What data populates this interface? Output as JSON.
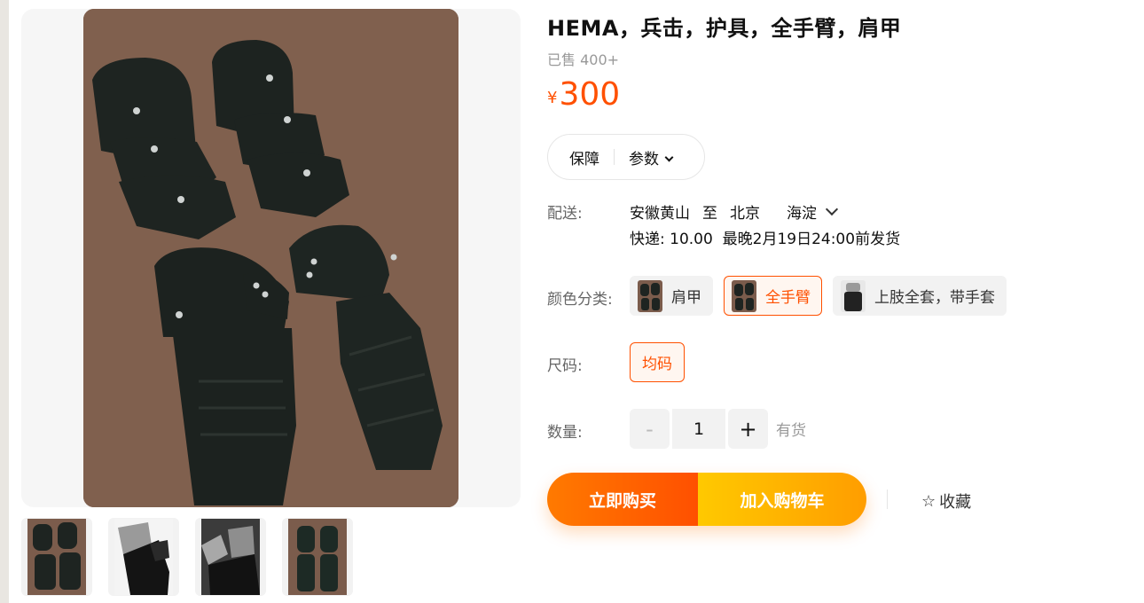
{
  "product": {
    "title": "HEMA，兵击，护具，全手臂，肩甲",
    "sold": "已售 400+",
    "currency": "¥",
    "price": "300"
  },
  "chips": {
    "guarantee": "保障",
    "params": "参数"
  },
  "delivery": {
    "label": "配送:",
    "from": "安徽黄山",
    "to_word": "至",
    "city": "北京",
    "district": "海淀",
    "shipping": "快递: 10.00",
    "eta": "最晚2月19日24:00前发货"
  },
  "color": {
    "label": "颜色分类:",
    "options": [
      {
        "label": "肩甲",
        "selected": false
      },
      {
        "label": "全手臂",
        "selected": true
      },
      {
        "label": "上肢全套，带手套",
        "selected": false
      }
    ]
  },
  "size": {
    "label": "尺码:",
    "value": "均码"
  },
  "quantity": {
    "label": "数量:",
    "minus": "-",
    "value": "1",
    "plus": "+",
    "stock": "有货"
  },
  "actions": {
    "buy_now": "立即购买",
    "add_to_cart": "加入购物车",
    "favorite": "收藏"
  },
  "colors": {
    "accent": "#ff5000",
    "buy_gradient": [
      "#ff7a00",
      "#ff5000"
    ],
    "cart_gradient": [
      "#ffc900",
      "#ff9d00"
    ]
  },
  "icons": {
    "favorite": "star-outline-icon",
    "dropdown": "chevron-down-icon"
  }
}
